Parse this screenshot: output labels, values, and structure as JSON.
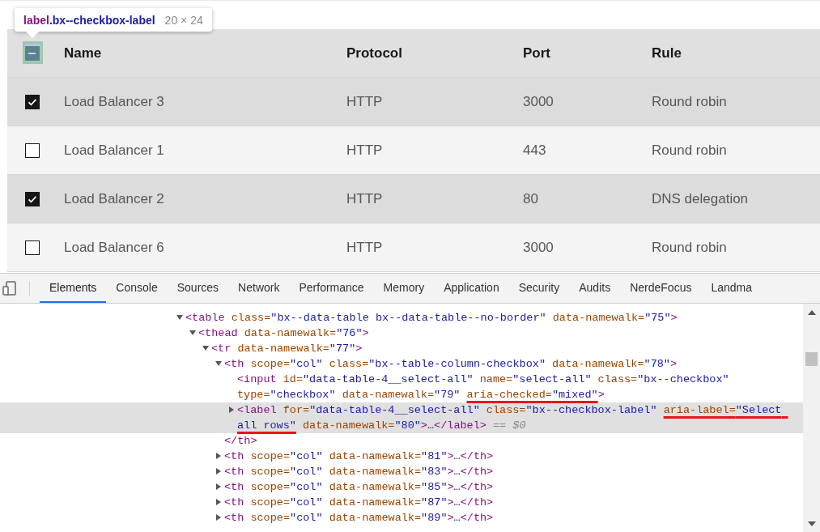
{
  "inspector_tooltip": {
    "tag": "label",
    "selector": ".bx--checkbox-label",
    "size": "20 × 24"
  },
  "table": {
    "select_all": {
      "indeterminate": true
    },
    "columns": [
      "Name",
      "Protocol",
      "Port",
      "Rule"
    ],
    "rows": [
      {
        "checked": true,
        "cells": [
          "Load Balancer 3",
          "HTTP",
          "3000",
          "Round robin"
        ]
      },
      {
        "checked": false,
        "cells": [
          "Load Balancer 1",
          "HTTP",
          "443",
          "Round robin"
        ]
      },
      {
        "checked": true,
        "cells": [
          "Load Balancer 2",
          "HTTP",
          "80",
          "DNS delegation"
        ]
      },
      {
        "checked": false,
        "cells": [
          "Load Balancer 6",
          "HTTP",
          "3000",
          "Round robin"
        ]
      }
    ]
  },
  "devtools": {
    "tabs": [
      {
        "label": "Elements",
        "selected": true
      },
      {
        "label": "Console",
        "selected": false
      },
      {
        "label": "Sources",
        "selected": false
      },
      {
        "label": "Network",
        "selected": false
      },
      {
        "label": "Performance",
        "selected": false
      },
      {
        "label": "Memory",
        "selected": false
      },
      {
        "label": "Application",
        "selected": false
      },
      {
        "label": "Security",
        "selected": false
      },
      {
        "label": "Audits",
        "selected": false
      },
      {
        "label": "NerdeFocus",
        "selected": false
      },
      {
        "label": "Landma",
        "selected": false
      }
    ],
    "elements_tree": [
      {
        "kind": "expanded",
        "selected": false,
        "open": [
          {
            "kind": "tag",
            "text": "<table"
          },
          {
            "kind": "attr",
            "text": " class="
          },
          {
            "kind": "value",
            "text": "\"bx--data-table bx--data-table--no-border\""
          },
          {
            "kind": "attr",
            "text": " data-namewalk="
          },
          {
            "kind": "value",
            "text": "\"75\""
          },
          {
            "kind": "tag",
            "text": ">"
          }
        ],
        "children": [
          {
            "kind": "expanded",
            "selected": false,
            "open": [
              {
                "kind": "tag",
                "text": "<thead"
              },
              {
                "kind": "attr",
                "text": " data-namewalk="
              },
              {
                "kind": "value",
                "text": "\"76\""
              },
              {
                "kind": "tag",
                "text": ">"
              }
            ],
            "children": [
              {
                "kind": "expanded",
                "selected": false,
                "open": [
                  {
                    "kind": "tag",
                    "text": "<tr"
                  },
                  {
                    "kind": "attr",
                    "text": " data-namewalk="
                  },
                  {
                    "kind": "value",
                    "text": "\"77\""
                  },
                  {
                    "kind": "tag",
                    "text": ">"
                  }
                ],
                "children": [
                  {
                    "kind": "expanded",
                    "selected": false,
                    "open": [
                      {
                        "kind": "tag",
                        "text": "<th"
                      },
                      {
                        "kind": "attr",
                        "text": " scope="
                      },
                      {
                        "kind": "value",
                        "text": "\"col\""
                      },
                      {
                        "kind": "attr",
                        "text": " class="
                      },
                      {
                        "kind": "value",
                        "text": "\"bx--table-column-checkbox\""
                      },
                      {
                        "kind": "attr",
                        "text": " data-namewalk="
                      },
                      {
                        "kind": "value",
                        "text": "\"78\""
                      },
                      {
                        "kind": "tag",
                        "text": ">"
                      }
                    ],
                    "children": [
                      {
                        "kind": "leaf",
                        "selected": false,
                        "open": [
                          {
                            "kind": "tag",
                            "text": "<input"
                          },
                          {
                            "kind": "attr",
                            "text": " id="
                          },
                          {
                            "kind": "value",
                            "text": "\"data-table-4__select-all\""
                          },
                          {
                            "kind": "attr",
                            "text": " name="
                          },
                          {
                            "kind": "value",
                            "text": "\"select-all\""
                          },
                          {
                            "kind": "attr",
                            "text": " class="
                          },
                          {
                            "kind": "value",
                            "text": "\"bx--checkbox\""
                          },
                          {
                            "kind": "attr",
                            "text": " type="
                          },
                          {
                            "kind": "value",
                            "text": "\"checkbox\""
                          },
                          {
                            "kind": "attr",
                            "text": " data-namewalk="
                          },
                          {
                            "kind": "value",
                            "text": "\"79\" "
                          },
                          {
                            "kind": "marked_attr",
                            "text": "aria-checked="
                          },
                          {
                            "kind": "marked_value",
                            "text": "\"mixed\""
                          },
                          {
                            "kind": "tag",
                            "text": ">"
                          }
                        ]
                      },
                      {
                        "kind": "collapsed",
                        "selected": true,
                        "open": [
                          {
                            "kind": "tag",
                            "text": "<label"
                          },
                          {
                            "kind": "attr",
                            "text": " for="
                          },
                          {
                            "kind": "value",
                            "text": "\"data-table-4__select-all\""
                          },
                          {
                            "kind": "attr",
                            "text": " class="
                          },
                          {
                            "kind": "value",
                            "text": "\"bx--checkbox-label\" "
                          },
                          {
                            "kind": "marked_attr",
                            "text": "aria-label="
                          },
                          {
                            "kind": "marked_value",
                            "text": "\"Select all rows\""
                          },
                          {
                            "kind": "attr",
                            "text": " data-namewalk="
                          },
                          {
                            "kind": "value",
                            "text": "\"80\""
                          },
                          {
                            "kind": "tag",
                            "text": ">"
                          },
                          {
                            "kind": "plain",
                            "text": "…"
                          },
                          {
                            "kind": "tag",
                            "text": "</label>"
                          },
                          {
                            "kind": "note",
                            "text": " == $0"
                          }
                        ]
                      }
                    ],
                    "close": [
                      {
                        "kind": "tag",
                        "text": "</th>"
                      }
                    ]
                  },
                  {
                    "kind": "collapsed",
                    "selected": false,
                    "open": [
                      {
                        "kind": "tag",
                        "text": "<th"
                      },
                      {
                        "kind": "attr",
                        "text": " scope="
                      },
                      {
                        "kind": "value",
                        "text": "\"col\""
                      },
                      {
                        "kind": "attr",
                        "text": " data-namewalk="
                      },
                      {
                        "kind": "value",
                        "text": "\"81\""
                      },
                      {
                        "kind": "tag",
                        "text": ">"
                      },
                      {
                        "kind": "plain",
                        "text": "…"
                      },
                      {
                        "kind": "tag",
                        "text": "</th>"
                      }
                    ]
                  },
                  {
                    "kind": "collapsed",
                    "selected": false,
                    "open": [
                      {
                        "kind": "tag",
                        "text": "<th"
                      },
                      {
                        "kind": "attr",
                        "text": " scope="
                      },
                      {
                        "kind": "value",
                        "text": "\"col\""
                      },
                      {
                        "kind": "attr",
                        "text": " data-namewalk="
                      },
                      {
                        "kind": "value",
                        "text": "\"83\""
                      },
                      {
                        "kind": "tag",
                        "text": ">"
                      },
                      {
                        "kind": "plain",
                        "text": "…"
                      },
                      {
                        "kind": "tag",
                        "text": "</th>"
                      }
                    ]
                  },
                  {
                    "kind": "collapsed",
                    "selected": false,
                    "open": [
                      {
                        "kind": "tag",
                        "text": "<th"
                      },
                      {
                        "kind": "attr",
                        "text": " scope="
                      },
                      {
                        "kind": "value",
                        "text": "\"col\""
                      },
                      {
                        "kind": "attr",
                        "text": " data-namewalk="
                      },
                      {
                        "kind": "value",
                        "text": "\"85\""
                      },
                      {
                        "kind": "tag",
                        "text": ">"
                      },
                      {
                        "kind": "plain",
                        "text": "…"
                      },
                      {
                        "kind": "tag",
                        "text": "</th>"
                      }
                    ]
                  },
                  {
                    "kind": "collapsed",
                    "selected": false,
                    "open": [
                      {
                        "kind": "tag",
                        "text": "<th"
                      },
                      {
                        "kind": "attr",
                        "text": " scope="
                      },
                      {
                        "kind": "value",
                        "text": "\"col\""
                      },
                      {
                        "kind": "attr",
                        "text": " data-namewalk="
                      },
                      {
                        "kind": "value",
                        "text": "\"87\""
                      },
                      {
                        "kind": "tag",
                        "text": ">"
                      },
                      {
                        "kind": "plain",
                        "text": "…"
                      },
                      {
                        "kind": "tag",
                        "text": "</th>"
                      }
                    ]
                  },
                  {
                    "kind": "collapsed",
                    "selected": false,
                    "open": [
                      {
                        "kind": "tag",
                        "text": "<th"
                      },
                      {
                        "kind": "attr",
                        "text": " scope="
                      },
                      {
                        "kind": "value",
                        "text": "\"col\""
                      },
                      {
                        "kind": "attr",
                        "text": " data-namewalk="
                      },
                      {
                        "kind": "value",
                        "text": "\"89\""
                      },
                      {
                        "kind": "tag",
                        "text": ">"
                      },
                      {
                        "kind": "plain",
                        "text": "…"
                      },
                      {
                        "kind": "tag",
                        "text": "</th>"
                      }
                    ]
                  }
                ]
              }
            ]
          }
        ]
      }
    ]
  }
}
